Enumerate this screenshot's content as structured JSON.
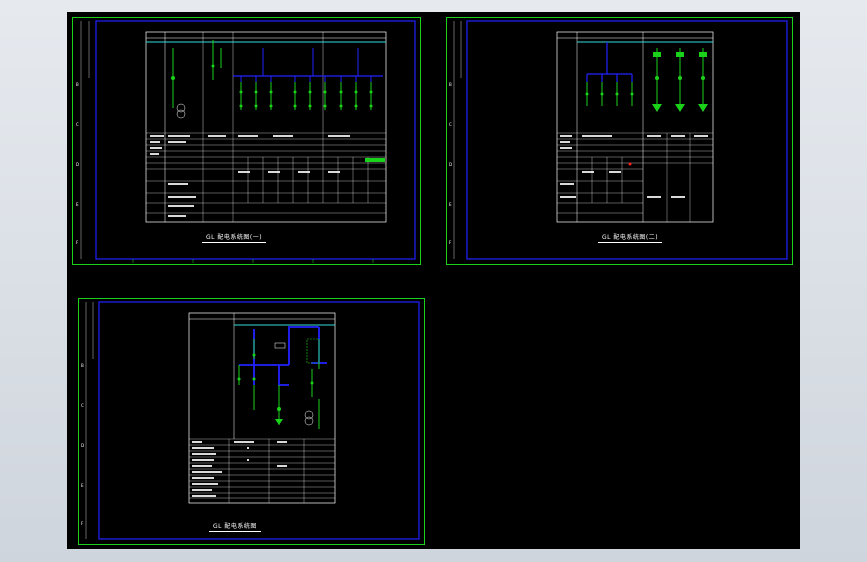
{
  "app": {
    "title": ""
  },
  "colors": {
    "background": "#000000",
    "frame": "#1bd21b",
    "border": "#2222ff",
    "table": "#ffffff",
    "bus": "#2222ff",
    "component": "#1bd21b",
    "highlight": "#ff2020",
    "cyan": "#33dddd"
  },
  "sheets": [
    {
      "id": "sheet-1",
      "caption": "GL 配电系统图(一)"
    },
    {
      "id": "sheet-2",
      "caption": "GL 配电系统图(二)"
    },
    {
      "id": "sheet-3",
      "caption": "GL 配电系统图"
    }
  ],
  "frame_labels": {
    "rows": [
      "B",
      "C",
      "D",
      "E",
      "F"
    ],
    "row_marks": [
      "A",
      "B",
      "C",
      "D",
      "E",
      "F"
    ]
  }
}
